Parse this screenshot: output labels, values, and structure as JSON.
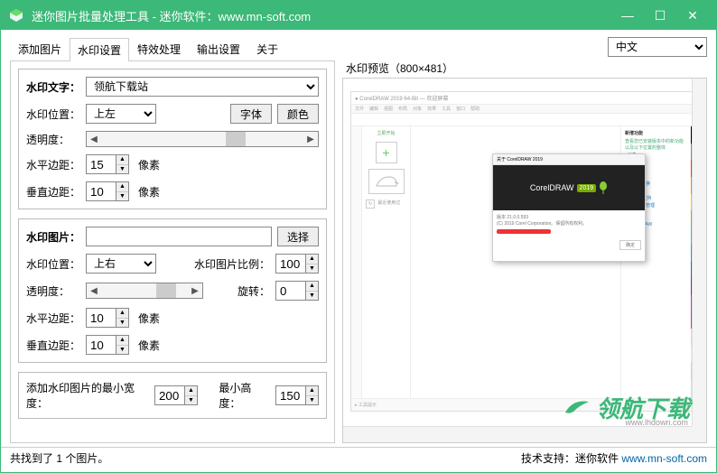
{
  "window": {
    "title": "迷你图片批量处理工具 - 迷你软件：www.mn-soft.com"
  },
  "tabs": {
    "t1": "添加图片",
    "t2": "水印设置",
    "t3": "特效处理",
    "t4": "输出设置",
    "t5": "关于"
  },
  "language": {
    "value": "中文"
  },
  "text_wm": {
    "label": "水印文字：",
    "value": "领航下载站",
    "pos_label": "水印位置：",
    "pos_value": "上左",
    "font_btn": "字体",
    "color_btn": "颜色",
    "opacity_label": "透明度：",
    "hmargin_label": "水平边距：",
    "hmargin_value": "15",
    "vmargin_label": "垂直边距：",
    "vmargin_value": "10",
    "unit": "像素"
  },
  "img_wm": {
    "label": "水印图片：",
    "value": "",
    "select_btn": "选择",
    "pos_label": "水印位置：",
    "pos_value": "上右",
    "ratio_label": "水印图片比例：",
    "ratio_value": "100",
    "opacity_label": "透明度：",
    "rotate_label": "旋转：",
    "rotate_value": "0",
    "hmargin_label": "水平边距：",
    "hmargin_value": "10",
    "vmargin_label": "垂直边距：",
    "vmargin_value": "10",
    "unit": "像素"
  },
  "min_size": {
    "width_label": "添加水印图片的最小宽度：",
    "width_value": "200",
    "height_label": "最小高度：",
    "height_value": "150"
  },
  "preview": {
    "label": "水印预览（800×481）",
    "brand": "领航下载",
    "brand_sub": "www.lhdown.com",
    "dialog_title": "关于 CorelDRAW 2019",
    "dialog_logo": "CorelDRAW",
    "dialog_year": "2019",
    "dialog_ver": "版本 21.0.0.593",
    "dialog_copy": "(C) 2019 Corel Corporation。保留所有权利。",
    "dialog_ok": "确定",
    "side_tab": "欢迎屏幕",
    "side_start": "立即开始",
    "side_new": "新建",
    "right_h1": "新增功能",
    "right_h2": "了解详情"
  },
  "status": {
    "left": "共找到了 1 个图片。",
    "right_label": "技术支持：迷你软件 ",
    "right_link": "www.mn-soft.com"
  }
}
